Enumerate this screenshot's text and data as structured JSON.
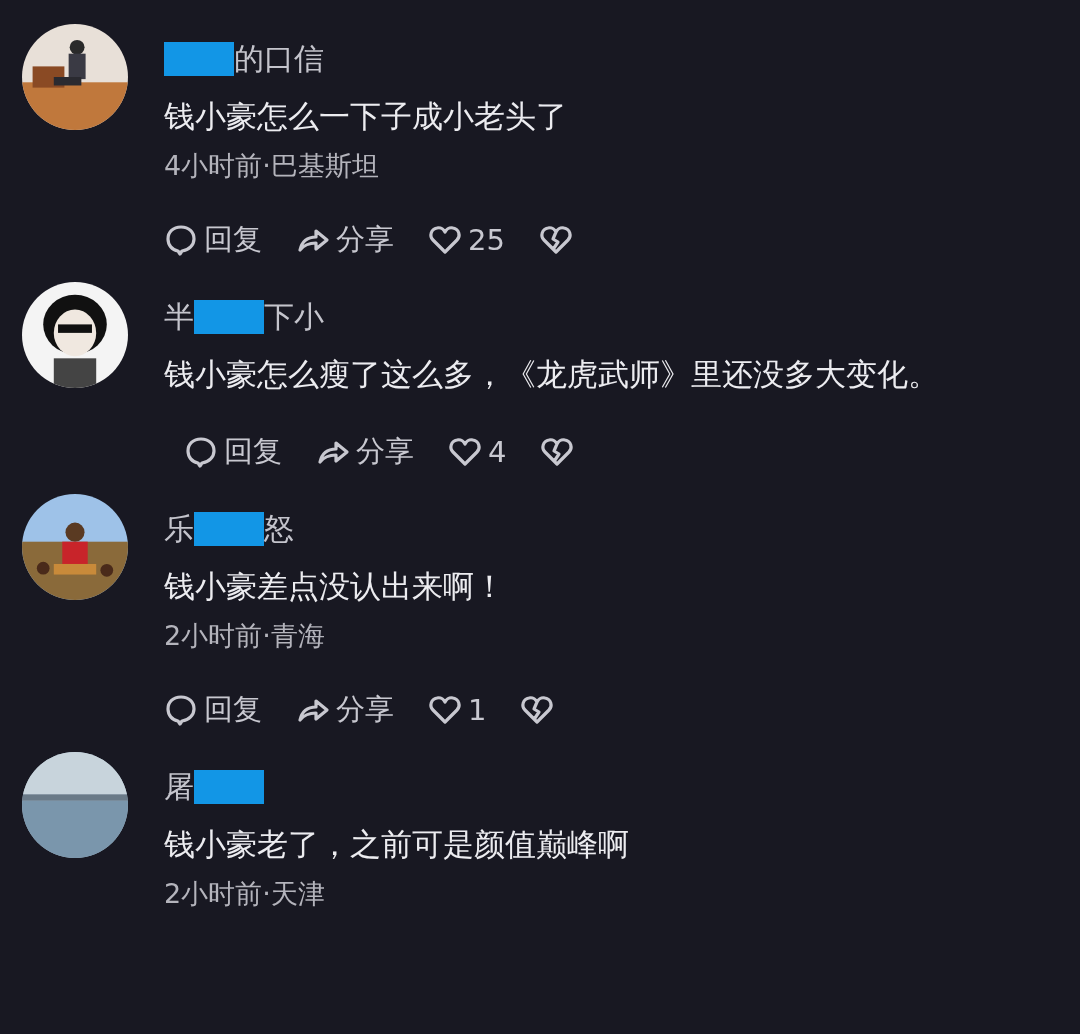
{
  "comments": [
    {
      "name_after": "的口信",
      "text": "钱小豪怎么一下子成小老头了",
      "meta": "4小时前·巴基斯坦",
      "actions": {
        "reply": "回复",
        "share": "分享",
        "likes": "25"
      }
    },
    {
      "name_before": "半",
      "name_after": "下小",
      "text": "钱小豪怎么瘦了这么多，《龙虎武师》里还没多大变化。",
      "actions": {
        "reply": "回复",
        "share": "分享",
        "likes": "4"
      }
    },
    {
      "name_before": "乐",
      "name_after": "怒",
      "text": "钱小豪差点没认出来啊！",
      "meta": "2小时前·青海",
      "actions": {
        "reply": "回复",
        "share": "分享",
        "likes": "1"
      }
    },
    {
      "name_before": "屠",
      "text": "钱小豪老了，之前可是颜值巅峰啊",
      "meta": "2小时前·天津"
    }
  ]
}
